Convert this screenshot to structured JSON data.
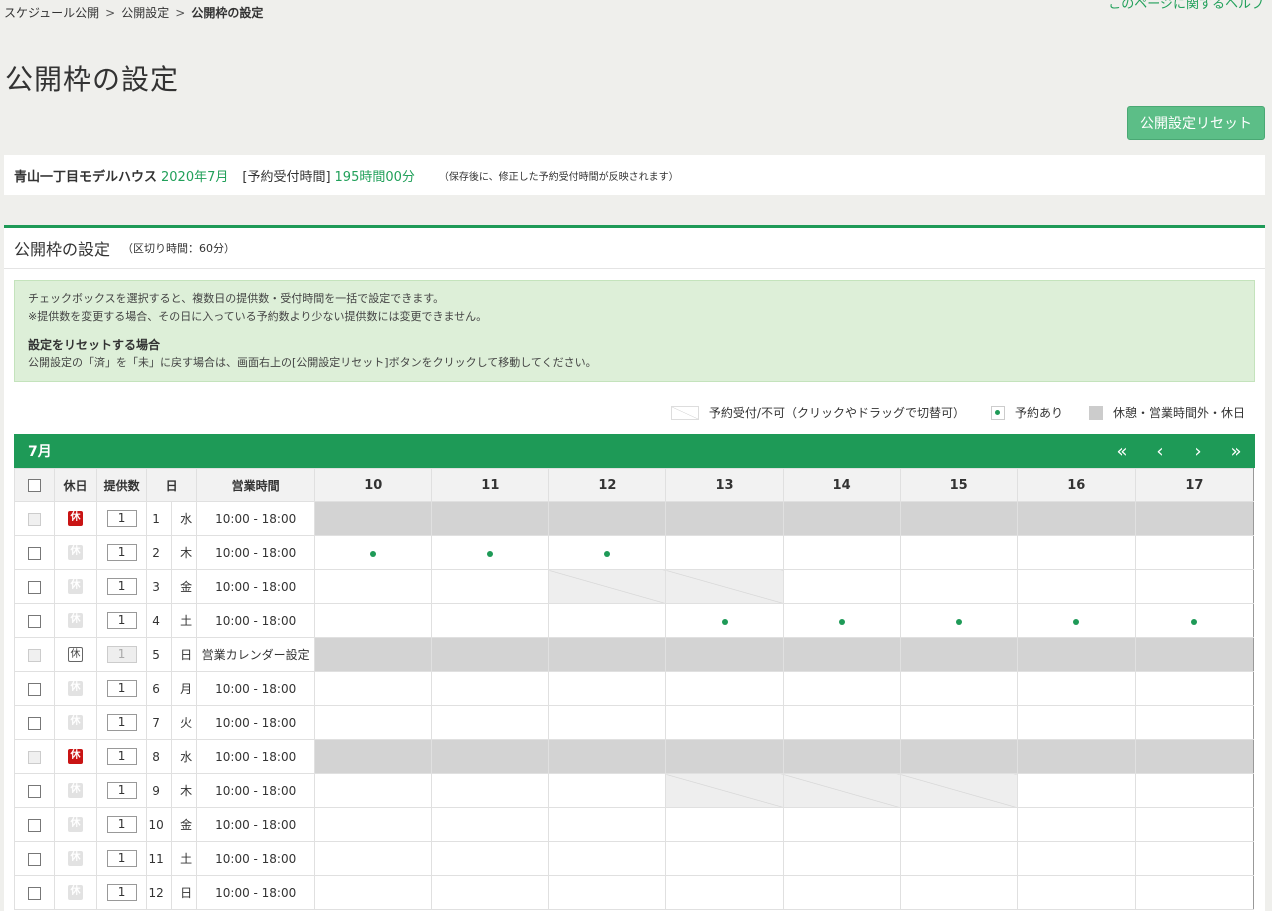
{
  "breadcrumb": {
    "item1": "スケジュール公開",
    "sep": ">",
    "item2": "公開設定",
    "current": "公開枠の設定"
  },
  "help_link": "このページに関するヘルプ",
  "page_title": "公開枠の設定",
  "reset_button": "公開設定リセット",
  "info": {
    "house": "青山一丁目モデルハウス",
    "month": "2020年7月",
    "hours_label": "[予約受付時間]",
    "hours_value": "195時間00分",
    "note": "（保存後に、修正した予約受付時間が反映されます）"
  },
  "panel": {
    "title": "公開枠の設定",
    "subtitle": "（区切り時間：60分）"
  },
  "notice": {
    "line1": "チェックボックスを選択すると、複数日の提供数・受付時間を一括で設定できます。",
    "line2": "※提供数を変更する場合、その日に入っている予約数より少ない提供数には変更できません。",
    "heading": "設定をリセットする場合",
    "line3": "公開設定の「済」を「未」に戻す場合は、画面右上の[公開設定リセット]ボタンをクリックして移動してください。"
  },
  "legend": {
    "toggle": "予約受付/不可（クリックやドラッグで切替可）",
    "booked": "予約あり",
    "closed": "休憩・営業時間外・休日"
  },
  "month_label": "7月",
  "nav": {
    "first": "«",
    "prev": "‹",
    "next": "›",
    "last": "»"
  },
  "columns": {
    "holiday": "休日",
    "quantity": "提供数",
    "day": "日",
    "business_hours": "営業時間",
    "hours": [
      "10",
      "11",
      "12",
      "13",
      "14",
      "15",
      "16",
      "17"
    ]
  },
  "holiday_glyph": "休",
  "rows": [
    {
      "day": "1",
      "weekday": "水",
      "wd_type": "",
      "qty": "1",
      "hours": "10:00 - 18:00",
      "holiday": "on",
      "enabled": false,
      "closed": true,
      "dots": [],
      "hatch": []
    },
    {
      "day": "2",
      "weekday": "木",
      "wd_type": "",
      "qty": "1",
      "hours": "10:00 - 18:00",
      "holiday": "off",
      "enabled": true,
      "closed": false,
      "dots": [
        0,
        1,
        2
      ],
      "hatch": []
    },
    {
      "day": "3",
      "weekday": "金",
      "wd_type": "",
      "qty": "1",
      "hours": "10:00 - 18:00",
      "holiday": "off",
      "enabled": true,
      "closed": false,
      "dots": [],
      "hatch": [
        2,
        3
      ]
    },
    {
      "day": "4",
      "weekday": "土",
      "wd_type": "sat",
      "qty": "1",
      "hours": "10:00 - 18:00",
      "holiday": "off",
      "enabled": true,
      "closed": false,
      "dots": [
        3,
        4,
        5,
        6,
        7
      ],
      "hatch": []
    },
    {
      "day": "5",
      "weekday": "日",
      "wd_type": "sun",
      "qty": "1",
      "hours": "営業カレンダー設定",
      "holiday": "out",
      "enabled": false,
      "closed": true,
      "dots": [],
      "hatch": []
    },
    {
      "day": "6",
      "weekday": "月",
      "wd_type": "",
      "qty": "1",
      "hours": "10:00 - 18:00",
      "holiday": "off",
      "enabled": true,
      "closed": false,
      "dots": [],
      "hatch": []
    },
    {
      "day": "7",
      "weekday": "火",
      "wd_type": "",
      "qty": "1",
      "hours": "10:00 - 18:00",
      "holiday": "off",
      "enabled": true,
      "closed": false,
      "dots": [],
      "hatch": []
    },
    {
      "day": "8",
      "weekday": "水",
      "wd_type": "",
      "qty": "1",
      "hours": "10:00 - 18:00",
      "holiday": "on",
      "enabled": false,
      "closed": true,
      "dots": [],
      "hatch": []
    },
    {
      "day": "9",
      "weekday": "木",
      "wd_type": "",
      "qty": "1",
      "hours": "10:00 - 18:00",
      "holiday": "off",
      "enabled": true,
      "closed": false,
      "dots": [],
      "hatch": [
        3,
        4,
        5
      ]
    },
    {
      "day": "10",
      "weekday": "金",
      "wd_type": "",
      "qty": "1",
      "hours": "10:00 - 18:00",
      "holiday": "off",
      "enabled": true,
      "closed": false,
      "dots": [],
      "hatch": []
    },
    {
      "day": "11",
      "weekday": "土",
      "wd_type": "sat",
      "qty": "1",
      "hours": "10:00 - 18:00",
      "holiday": "off",
      "enabled": true,
      "closed": false,
      "dots": [],
      "hatch": []
    },
    {
      "day": "12",
      "weekday": "日",
      "wd_type": "sun",
      "qty": "1",
      "hours": "10:00 - 18:00",
      "holiday": "off",
      "enabled": true,
      "closed": false,
      "dots": [],
      "hatch": []
    }
  ],
  "colors": {
    "brand_green": "#1e9a57",
    "reset_button": "#5cbe87",
    "holiday_red": "#c91414",
    "closed_grey": "#d3d3d3",
    "saturday": "#1010cc",
    "sunday": "#d01010"
  }
}
